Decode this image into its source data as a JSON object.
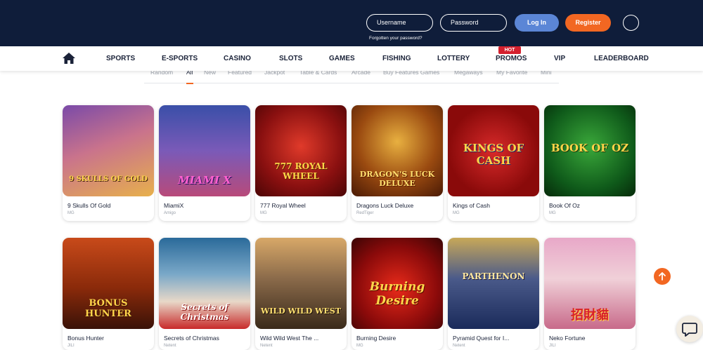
{
  "header": {
    "username_placeholder": "Username",
    "password_placeholder": "Password",
    "login_label": "Log In",
    "register_label": "Register",
    "forgot_password": "Forgotten your password?"
  },
  "nav": {
    "items": [
      "SPORTS",
      "E-SPORTS",
      "CASINO",
      "SLOTS",
      "GAMES",
      "FISHING",
      "LOTTERY",
      "PROMOS",
      "VIP",
      "LEADERBOARD"
    ],
    "hot_badge": "HOT"
  },
  "subtabs": [
    "Random",
    "All",
    "New",
    "Featured",
    "Jackpot",
    "Table & Cards",
    "Arcade",
    "Buy Features Games",
    "Megaways",
    "My Favorite",
    "Mini"
  ],
  "games": [
    {
      "title": "9 Skulls Of Gold",
      "provider": "MG",
      "art_text": "9 SKULLS OF GOLD"
    },
    {
      "title": "MiamiX",
      "provider": "Amigo",
      "art_text": "MIAMI X"
    },
    {
      "title": "777 Royal Wheel",
      "provider": "MG",
      "art_text": "777 ROYAL WHEEL"
    },
    {
      "title": "Dragons Luck Deluxe",
      "provider": "RedTiger",
      "art_text": "DRAGON'S LUCK DELUXE"
    },
    {
      "title": "Kings of Cash",
      "provider": "MG",
      "art_text": "KINGS OF CASH"
    },
    {
      "title": "Book Of Oz",
      "provider": "MG",
      "art_text": "BOOK OF OZ"
    },
    {
      "title": "Bonus Hunter",
      "provider": "JILI",
      "art_text": "BONUS HUNTER"
    },
    {
      "title": "Secrets of Christmas",
      "provider": "Netent",
      "art_text": "Secrets of Christmas"
    },
    {
      "title": "Wild Wild West The ...",
      "provider": "Netent",
      "art_text": "WILD WILD WEST"
    },
    {
      "title": "Burning Desire",
      "provider": "MG",
      "art_text": "Burning Desire"
    },
    {
      "title": "Pyramid Quest for I...",
      "provider": "Netent",
      "art_text": "PARTHENON"
    },
    {
      "title": "Neko Fortune",
      "provider": "JILI",
      "art_text": "招財貓"
    }
  ],
  "colors": {
    "header_bg": "#0f1d3a",
    "login_button": "#5b86d6",
    "register_button": "#f26722",
    "accent": "#f26722",
    "hot_badge": "#d4202e"
  },
  "icons": [
    "home-icon",
    "chevron-up-icon",
    "chat-icon"
  ]
}
